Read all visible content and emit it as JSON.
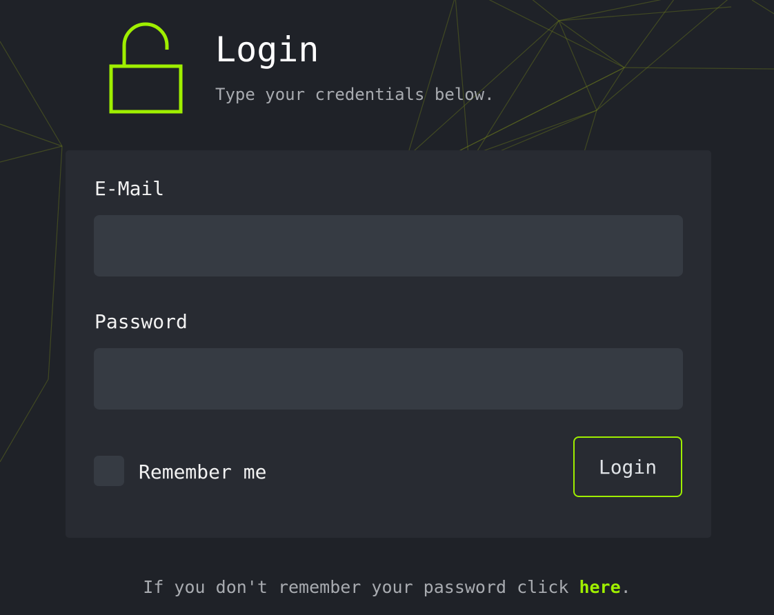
{
  "header": {
    "title": "Login",
    "subtitle": "Type your credentials below."
  },
  "form": {
    "email_label": "E-Mail",
    "email_value": "",
    "password_label": "Password",
    "password_value": "",
    "remember_label": "Remember me",
    "remember_checked": false,
    "submit_label": "Login"
  },
  "footer": {
    "text_before": "If you don't remember your password click ",
    "link_text": "here",
    "text_after": "."
  },
  "icons": {
    "lock": "open-padlock-icon"
  },
  "colors": {
    "background": "#1f2228",
    "card": "#282b32",
    "input": "#363b43",
    "accent": "#9fef00",
    "text": "#f2f2f2",
    "muted_text": "#a8abb0"
  }
}
